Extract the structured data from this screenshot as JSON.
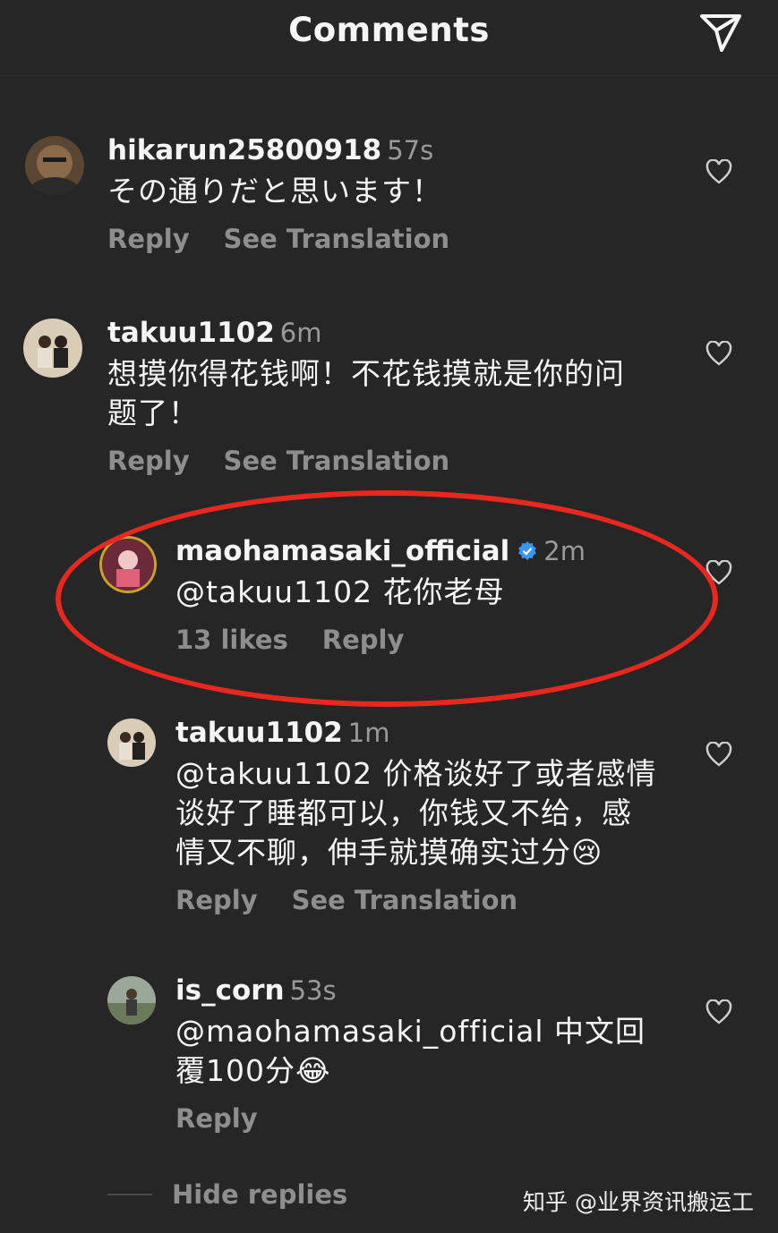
{
  "header": {
    "title": "Comments",
    "send_icon": "send-icon"
  },
  "comments": [
    {
      "username": "hikarun25800918",
      "time": "57s",
      "text": "その通りだと思います！",
      "actions": [
        "Reply",
        "See Translation"
      ],
      "avatar_icon": "avatar-photo"
    },
    {
      "username": "takuu1102",
      "time": "6m",
      "text_lines": [
        "想摸你得花钱啊！不花钱摸就是你的问",
        "题了！"
      ],
      "actions": [
        "Reply",
        "See Translation"
      ],
      "avatar_icon": "avatar-photo"
    }
  ],
  "replies": [
    {
      "username": "maohamasaki_official",
      "verified": true,
      "time": "2m",
      "text": "@takuu1102 花你老母",
      "actions": [
        "13 likes",
        "Reply"
      ],
      "avatar_icon": "avatar-photo"
    },
    {
      "username": "takuu1102",
      "time": "1m",
      "text_lines": [
        "@takuu1102 价格谈好了或者感情",
        "谈好了睡都可以，你钱又不给，感",
        "情又不聊，伸手就摸确实过分😢"
      ],
      "actions": [
        "Reply",
        "See Translation"
      ],
      "avatar_icon": "avatar-photo"
    },
    {
      "username": "is_corn",
      "time": "53s",
      "text_lines": [
        "@maohamasaki_official 中文回",
        "覆100分😂"
      ],
      "actions": [
        "Reply"
      ],
      "avatar_icon": "avatar-photo"
    }
  ],
  "hide_replies": "Hide replies",
  "watermark": "知乎 @业界资讯搬运工",
  "colors": {
    "background": "#262626",
    "secondary_text": "#8e8e8e",
    "highlight_oval": "#e8281e",
    "verified": "#3897f0"
  }
}
